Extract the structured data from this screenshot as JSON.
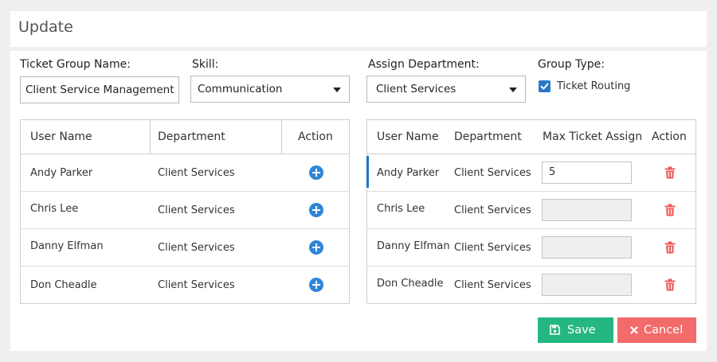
{
  "header": {
    "title": "Update"
  },
  "form": {
    "ticket_group_label": "Ticket Group Name:",
    "ticket_group_value": "Client Service Management",
    "skill_label": "Skill:",
    "skill_value": "Communication",
    "dept_label": "Assign Department:",
    "dept_value": "Client Services",
    "group_type_label": "Group Type:",
    "ticket_routing_label": "Ticket Routing",
    "ticket_routing_checked": true
  },
  "left_table": {
    "headers": {
      "user": "User Name",
      "dept": "Department",
      "action": "Action"
    },
    "rows": [
      {
        "user": "Andy Parker",
        "dept": "Client Services"
      },
      {
        "user": "Chris Lee",
        "dept": "Client Services"
      },
      {
        "user": "Danny Elfman",
        "dept": "Client Services"
      },
      {
        "user": "Don Cheadle",
        "dept": "Client Services"
      }
    ]
  },
  "right_table": {
    "headers": {
      "user": "User Name",
      "dept": "Department",
      "max": "Max Ticket Assign",
      "action": "Action"
    },
    "rows": [
      {
        "user": "Andy Parker",
        "dept": "Client Services",
        "max": "5"
      },
      {
        "user": "Chris Lee",
        "dept": "Client Services",
        "max": ""
      },
      {
        "user": "Danny Elfman",
        "dept": "Client Services",
        "max": ""
      },
      {
        "user": "Don Cheadle",
        "dept": "Client Services",
        "max": ""
      }
    ]
  },
  "buttons": {
    "save": "Save",
    "cancel": "Cancel"
  },
  "icons": {
    "add": "plus-circle-icon",
    "delete": "trash-icon",
    "save": "floppy-disk-icon",
    "cancel": "x-icon",
    "dropdown": "caret-down-icon",
    "checkbox": "checkmark-icon"
  },
  "colors": {
    "accent_blue": "#2f86d8",
    "save_green": "#25b781",
    "cancel_red": "#f16b6b",
    "trash_red": "#ef5b5b"
  }
}
